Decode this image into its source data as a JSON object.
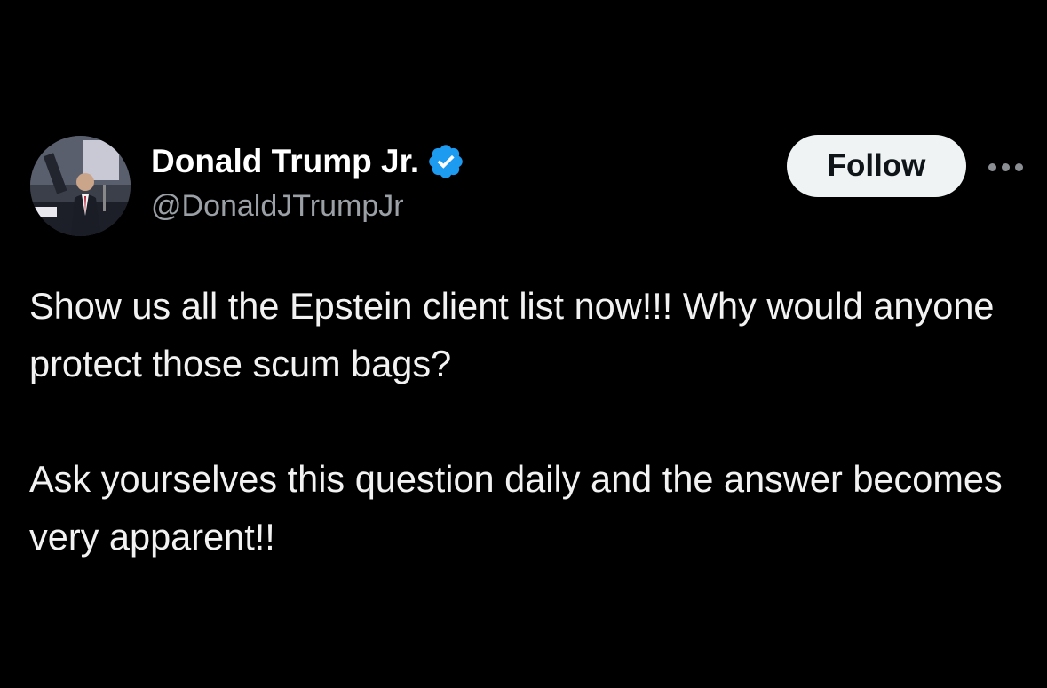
{
  "post": {
    "author": {
      "display_name": "Donald Trump Jr.",
      "handle": "@DonaldJTrumpJr",
      "verified": true,
      "avatar_icon": "profile-photo"
    },
    "follow_label": "Follow",
    "more_icon": "more-horizontal-icon",
    "paragraphs": [
      "Show us all the Epstein client list now!!! Why would anyone protect those scum bags?",
      "Ask yourselves this question daily and the answer becomes very apparent!!"
    ]
  },
  "colors": {
    "background": "#000000",
    "text": "#f2f2f2",
    "secondary_text": "#9aa0a6",
    "verified_badge": "#1d9bf0",
    "follow_button_bg": "#eff3f4",
    "follow_button_text": "#0f1419"
  }
}
